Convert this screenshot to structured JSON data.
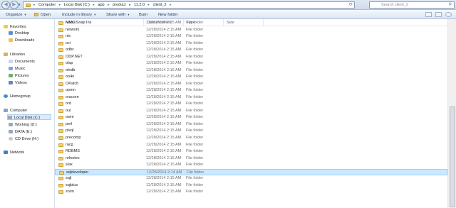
{
  "address": {
    "crumbs": [
      "Computer",
      "Local Disk (C:)",
      "app",
      "product",
      "11.2.0",
      "client_2"
    ],
    "separator": "▸",
    "search_placeholder": "Search client_2"
  },
  "toolbar": {
    "organize": "Organize",
    "open": "Open",
    "include": "Include in library",
    "share": "Share with",
    "burn": "Burn",
    "new_folder": "New folder"
  },
  "nav": {
    "favorites": "Favorites",
    "desktop": "Desktop",
    "downloads": "Downloads",
    "libraries": "Libraries",
    "documents": "Documents",
    "music": "Music",
    "pictures": "Pictures",
    "videos": "Videos",
    "homegroup": "Homegroup",
    "computer": "Computer",
    "local_disk": "Local Disk (C:)",
    "working": "Working (D:)",
    "data": "DATA (E:)",
    "cd_drive": "CD Drive (H:)",
    "network": "Network"
  },
  "columns": {
    "name": "Name",
    "date": "Date modified",
    "type": "Type",
    "size": "Size"
  },
  "files": [
    {
      "name": "MMC Snap Ins",
      "date": "12/28/2014 2:15 AM",
      "type": "File folder"
    },
    {
      "name": "network",
      "date": "12/28/2014 2:15 AM",
      "type": "File folder"
    },
    {
      "name": "nls",
      "date": "12/28/2014 2:15 AM",
      "type": "File folder"
    },
    {
      "name": "oci",
      "date": "12/28/2014 2:15 AM",
      "type": "File folder"
    },
    {
      "name": "odbc",
      "date": "12/28/2014 2:15 AM",
      "type": "File folder"
    },
    {
      "name": "ODP.NET",
      "date": "12/28/2014 2:15 AM",
      "type": "File folder"
    },
    {
      "name": "olap",
      "date": "12/28/2014 2:15 AM",
      "type": "File folder"
    },
    {
      "name": "oledb",
      "date": "12/28/2014 2:15 AM",
      "type": "File folder"
    },
    {
      "name": "oo4o",
      "date": "12/28/2014 2:15 AM",
      "type": "File folder"
    },
    {
      "name": "OPatch",
      "date": "12/28/2014 2:15 AM",
      "type": "File folder"
    },
    {
      "name": "opmn",
      "date": "12/28/2014 2:15 AM",
      "type": "File folder"
    },
    {
      "name": "oracore",
      "date": "12/28/2014 2:15 AM",
      "type": "File folder"
    },
    {
      "name": "ord",
      "date": "12/28/2014 2:15 AM",
      "type": "File folder"
    },
    {
      "name": "oui",
      "date": "12/28/2014 2:15 AM",
      "type": "File folder"
    },
    {
      "name": "owm",
      "date": "12/28/2014 2:15 AM",
      "type": "File folder"
    },
    {
      "name": "perl",
      "date": "12/28/2014 2:15 AM",
      "type": "File folder"
    },
    {
      "name": "plsql",
      "date": "12/28/2014 2:15 AM",
      "type": "File folder"
    },
    {
      "name": "precomp",
      "date": "12/28/2014 2:15 AM",
      "type": "File folder"
    },
    {
      "name": "racg",
      "date": "12/28/2014 2:15 AM",
      "type": "File folder"
    },
    {
      "name": "RDBMS",
      "date": "12/28/2014 2:15 AM",
      "type": "File folder"
    },
    {
      "name": "relnotes",
      "date": "12/28/2014 2:15 AM",
      "type": "File folder"
    },
    {
      "name": "slax",
      "date": "12/28/2014 2:15 AM",
      "type": "File folder"
    },
    {
      "name": "sqldeveloper",
      "date": "12/28/2014 2:14 AM",
      "type": "File folder",
      "selected": true
    },
    {
      "name": "sqlj",
      "date": "12/28/2014 2:15 AM",
      "type": "File folder"
    },
    {
      "name": "sqlplus",
      "date": "12/28/2014 2:15 AM",
      "type": "File folder"
    },
    {
      "name": "srvm",
      "date": "12/28/2014 2:15 AM",
      "type": "File folder"
    }
  ]
}
